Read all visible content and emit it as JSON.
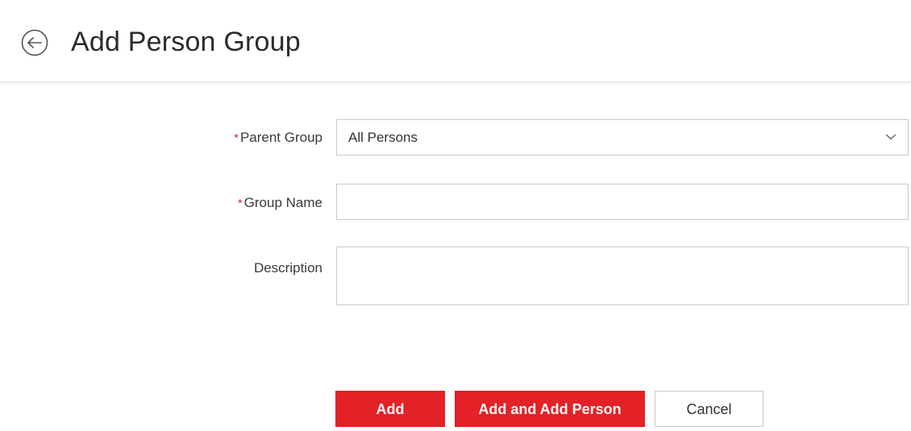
{
  "header": {
    "title": "Add Person Group",
    "back_icon": "back-arrow-circle-icon"
  },
  "form": {
    "required_mark": "*",
    "parent_group": {
      "label": "Parent Group",
      "value": "All Persons",
      "required": true
    },
    "group_name": {
      "label": "Group Name",
      "value": "",
      "required": true
    },
    "description": {
      "label": "Description",
      "value": "",
      "required": false
    }
  },
  "actions": {
    "add_label": "Add",
    "add_and_add_person_label": "Add and Add Person",
    "cancel_label": "Cancel"
  },
  "colors": {
    "accent": "#e42127",
    "required": "#e8262d",
    "border": "#c9c9c9"
  }
}
